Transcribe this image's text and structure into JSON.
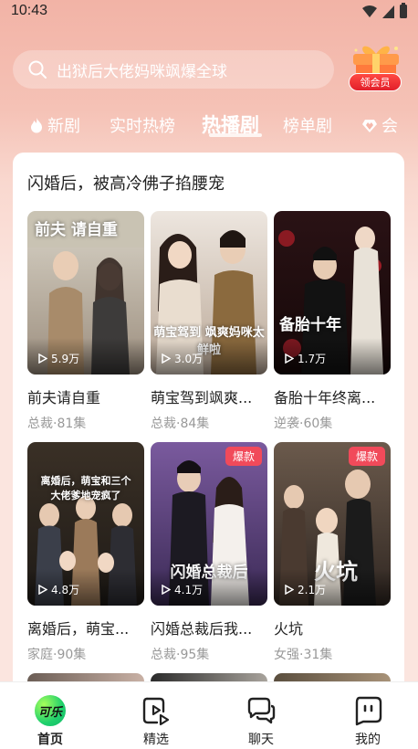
{
  "status": {
    "time": "10:43"
  },
  "search": {
    "placeholder": "出狱后大佬妈咪飒爆全球"
  },
  "vip": {
    "label": "领会员"
  },
  "tabs": [
    {
      "label": "新剧",
      "icon": "flame-icon"
    },
    {
      "label": "实时热榜"
    },
    {
      "label": "热播剧",
      "active": true
    },
    {
      "label": "榜单剧"
    },
    {
      "label": "会",
      "icon": "heart-diamond-icon"
    }
  ],
  "section": {
    "title": "闪婚后，被高冷佛子掐腰宠"
  },
  "dramas": [
    {
      "title": "前夫请自重",
      "meta": "总裁·81集",
      "plays": "5.9万",
      "caption": "前夫 请自重",
      "badge": ""
    },
    {
      "title": "萌宝驾到飒爽...",
      "meta": "总裁·84集",
      "plays": "3.0万",
      "caption": "萌宝驾到 飒爽妈咪太鲜啦",
      "badge": ""
    },
    {
      "title": "备胎十年终离...",
      "meta": "逆袭·60集",
      "plays": "1.7万",
      "caption": "备胎十年",
      "badge": ""
    },
    {
      "title": "离婚后，萌宝...",
      "meta": "家庭·90集",
      "plays": "4.8万",
      "caption": "离婚后，萌宝和三个大佬爹地宠疯了",
      "badge": ""
    },
    {
      "title": "闪婚总裁后我...",
      "meta": "总裁·95集",
      "plays": "4.1万",
      "caption": "闪婚总裁后",
      "badge": "爆款"
    },
    {
      "title": "火坑",
      "meta": "女强·31集",
      "plays": "2.1万",
      "caption": "火坑",
      "badge": "爆款"
    }
  ],
  "nav": [
    {
      "label": "首页",
      "icon": "app-logo-icon",
      "active": true,
      "logo_text": "可乐"
    },
    {
      "label": "精选",
      "icon": "video-play-icon"
    },
    {
      "label": "聊天",
      "icon": "chat-bubbles-icon"
    },
    {
      "label": "我的",
      "icon": "profile-face-icon"
    }
  ],
  "colors": {
    "accent": "#f14a5a",
    "header_bg": "#f2b3a6",
    "vip_red": "#e21f2a"
  }
}
